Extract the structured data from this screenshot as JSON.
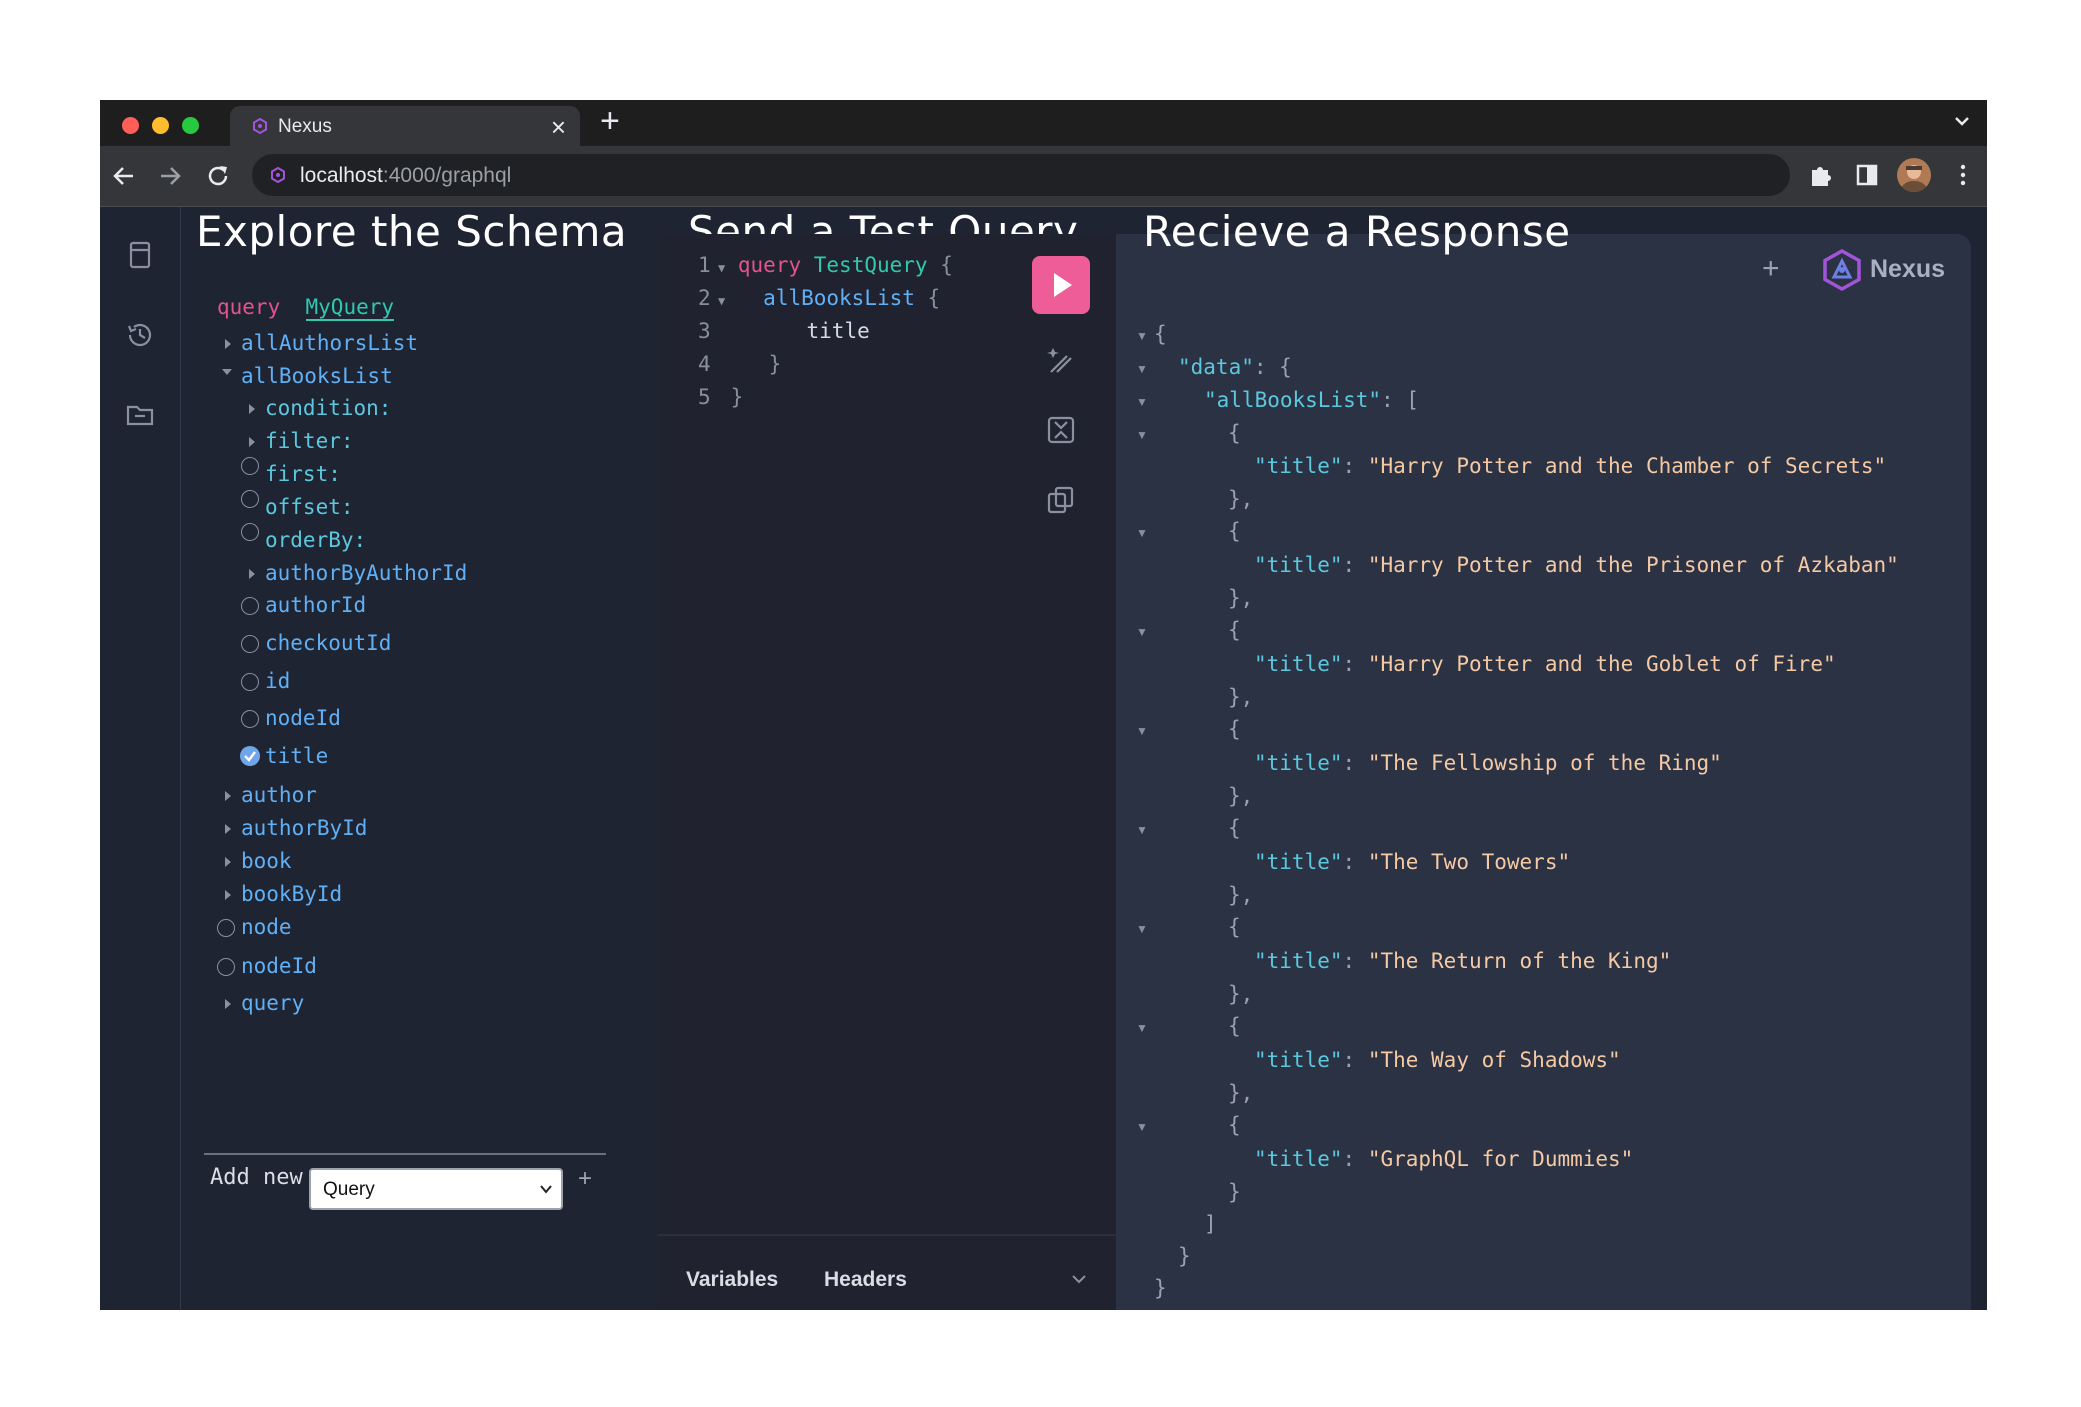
{
  "browser": {
    "tab_title": "Nexus",
    "url_host": "localhost",
    "url_path": ":4000/graphql"
  },
  "headings": {
    "explore": "Explore the Schema",
    "send": "Send a Test Query",
    "receive": "Recieve a Response"
  },
  "explorer": {
    "operation_keyword": "query",
    "operation_name": "MyQuery",
    "fields": {
      "allAuthorsList": "allAuthorsList",
      "allBooksList": "allBooksList",
      "condition": "condition:",
      "filter": "filter:",
      "first": "first:",
      "offset": "offset:",
      "orderBy": "orderBy:",
      "authorByAuthorId": "authorByAuthorId",
      "authorId": "authorId",
      "checkoutId": "checkoutId",
      "id": "id",
      "nodeId_inner": "nodeId",
      "title": "title",
      "author": "author",
      "authorById": "authorById",
      "book": "book",
      "bookById": "bookById",
      "node": "node",
      "nodeId": "nodeId",
      "query": "query"
    },
    "add_new_label": "Add new",
    "add_new_selected": "Query",
    "add_plus": "+"
  },
  "editor": {
    "lines": [
      {
        "n": "1",
        "kw": "query",
        "name": "TestQuery",
        "brace": "{"
      },
      {
        "n": "2",
        "field": "allBooksList",
        "brace": "{"
      },
      {
        "n": "3",
        "field": "title"
      },
      {
        "n": "4",
        "brace": "}"
      },
      {
        "n": "5",
        "brace": "}"
      }
    ],
    "footer_variables": "Variables",
    "footer_headers": "Headers"
  },
  "response": {
    "add_tab": "+",
    "brand": "Nexus",
    "data_key": "\"data\"",
    "list_key": "\"allBooksList\"",
    "title_key": "\"title\"",
    "titles": [
      "\"Harry Potter and the Chamber of Secrets\"",
      "\"Harry Potter and the Prisoner of Azkaban\"",
      "\"Harry Potter and the Goblet of Fire\"",
      "\"The Fellowship of the Ring\"",
      "\"The Two Towers\"",
      "\"The Return of the King\"",
      "\"The Way of Shadows\"",
      "\"GraphQL for Dummies\""
    ]
  },
  "colors": {
    "run_button": "#ef5d98",
    "keyword": "#e2548d",
    "field": "#60b0f5",
    "string": "#f5c9a3"
  }
}
